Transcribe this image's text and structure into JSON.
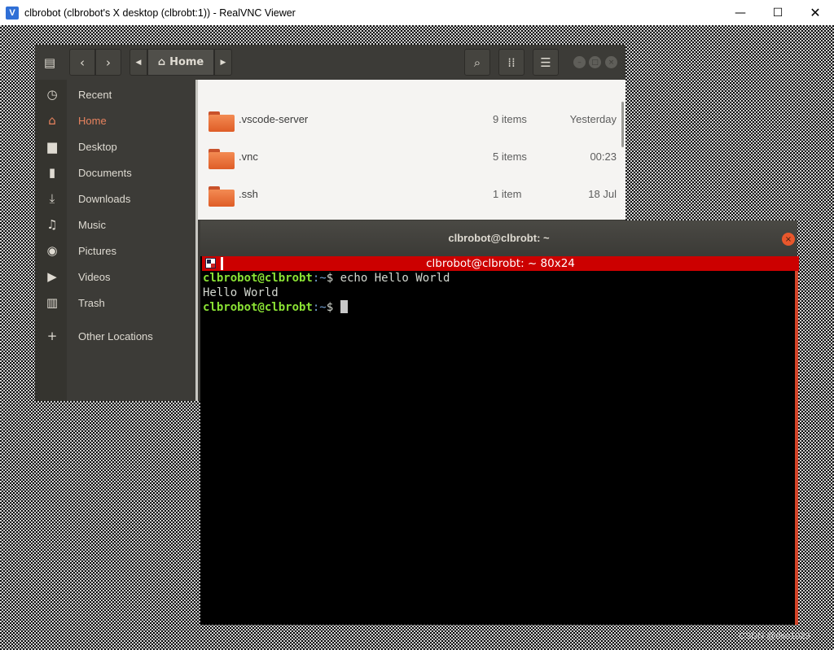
{
  "window": {
    "title": "clbrobot (clbrobot's X desktop (clbrobt:1)) - RealVNC Viewer",
    "min_glyph": "—",
    "max_glyph": "☐",
    "close_glyph": "✕"
  },
  "file_manager": {
    "location": "Home",
    "toolbar_icons": [
      "menu-icon",
      "back-icon",
      "forward-icon",
      "search-icon",
      "grid-view-icon",
      "list-menu-icon"
    ],
    "sidebar": [
      {
        "label": "Recent",
        "icon": "clock-icon",
        "glyph": "◷"
      },
      {
        "label": "Home",
        "icon": "home-icon",
        "glyph": "⌂",
        "active": true
      },
      {
        "label": "Desktop",
        "icon": "desktop-folder-icon",
        "glyph": "▆"
      },
      {
        "label": "Documents",
        "icon": "document-icon",
        "glyph": "▮"
      },
      {
        "label": "Downloads",
        "icon": "download-icon",
        "glyph": "⤓"
      },
      {
        "label": "Music",
        "icon": "music-icon",
        "glyph": "♫"
      },
      {
        "label": "Pictures",
        "icon": "camera-icon",
        "glyph": "◉"
      },
      {
        "label": "Videos",
        "icon": "video-icon",
        "glyph": "▶"
      },
      {
        "label": "Trash",
        "icon": "trash-icon",
        "glyph": "▥"
      },
      {
        "label": "Other Locations",
        "icon": "plus-icon",
        "glyph": "+"
      }
    ],
    "files": [
      {
        "name": ".vscode-server",
        "items": "9 items",
        "modified": "Yesterday"
      },
      {
        "name": ".vnc",
        "items": "5 items",
        "modified": "00:23"
      },
      {
        "name": ".ssh",
        "items": "1 item",
        "modified": "18 Jul"
      }
    ]
  },
  "terminal": {
    "window_title": "clbrobot@clbrobt: ~",
    "xterm_title": "clbrobot@clbrobt: ~ 80x24",
    "lines": [
      {
        "user": "clbrobot@clbrobt",
        "path": ":~",
        "text": "$ echo Hello World"
      },
      {
        "output": "Hello World"
      },
      {
        "user": "clbrobot@clbrobt",
        "path": ":~",
        "text": "$ "
      }
    ]
  },
  "watermark": "CSDN @dso1029"
}
